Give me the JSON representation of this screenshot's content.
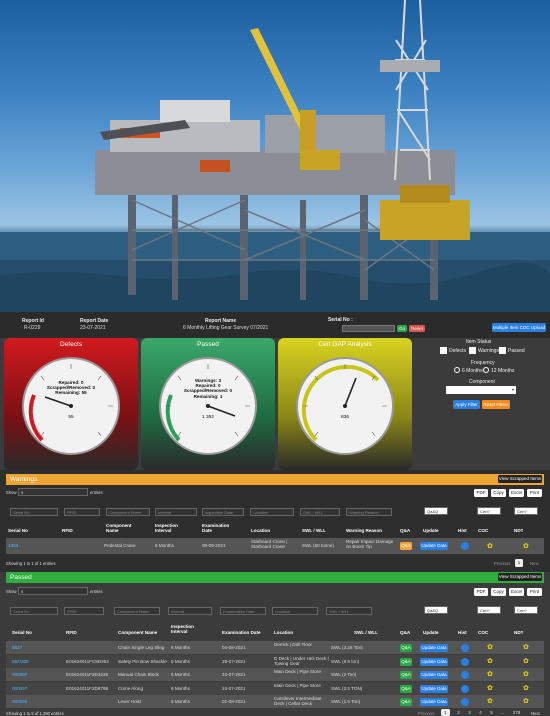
{
  "header": {
    "report_id_label": "Report Id",
    "report_id": "R-0229",
    "report_date_label": "Report Date",
    "report_date": "23-07-2021",
    "report_name_label": "Report Name",
    "report_name": "6 Monthly Lifting Gear Survey 07/2021",
    "serial_label": "Serial No :",
    "go_label": "Go",
    "reset_label": "Reset",
    "multiple_label": "Multiple Item COC Upload"
  },
  "gauges": [
    {
      "title": "Defects",
      "lines": [
        "Repaired: 0",
        "Scrapped/Removed: 0",
        "Remaining: 55"
      ],
      "value": "55",
      "color": "#c0151a"
    },
    {
      "title": "Passed",
      "lines": [
        "Warnings: 3",
        "Repaired: 0",
        "Scrapped/Removed: 0",
        "Remaining: 1"
      ],
      "value": "1 392",
      "color": "#2e9e5b"
    },
    {
      "title": "Cert GAP Analysis",
      "lines": [],
      "value": "836",
      "color": "#c9c41a"
    }
  ],
  "filter": {
    "item_status_label": "Item Status",
    "status_options": [
      "Defects",
      "Warnings",
      "Passed"
    ],
    "frequency_label": "Frequency",
    "frequency_options": [
      "6 Months",
      "12 Months"
    ],
    "component_label": "Component",
    "apply_label": "Apply Filter",
    "reset_label": "Reset Filters"
  },
  "warnings": {
    "title": "Warnings",
    "view_scrapped": "View Scrapped Items",
    "show_label": "Show",
    "show_value": "5",
    "entries_label": "entries",
    "export_buttons": [
      "PDF",
      "Copy",
      "Excel",
      "Print"
    ],
    "filters": [
      "Serial No",
      "RFID",
      "Component Name",
      "Interval",
      "Inspection Date",
      "Location",
      "SWL / WLL",
      "Warning Reason"
    ],
    "filter_selects": [
      "Qa&Q",
      "Cert?",
      "Cert?"
    ],
    "columns": [
      "Serial No",
      "RFID",
      "Component Name",
      "Inspection Interval",
      "Examination Date",
      "Location",
      "SWL / WLL",
      "Warning Reason",
      "Q&A",
      "Update",
      "Hist",
      "COC",
      "NDT"
    ],
    "rows": [
      {
        "serial": "1363",
        "rfid": "",
        "component": "Pedestal Crane",
        "interval": "6 Months",
        "date": "09-09-2021",
        "location": "Starboard Crane | Starboard Crane",
        "swl": "SWL (60 tonne)",
        "reason": "Repair Impact Damage on Boom Tip",
        "qa": "Q&A",
        "update": "Update Data"
      }
    ],
    "info": "Showing 1 to 1 of 1 entries",
    "previous": "Previous",
    "page": "1",
    "next": "Next"
  },
  "passed": {
    "title": "Passed",
    "view_scrapped": "View Scrapped Items",
    "show_label": "Show",
    "show_value": "5",
    "entries_label": "entries",
    "export_buttons": [
      "PDF",
      "Copy",
      "Excel",
      "Print"
    ],
    "filters": [
      "Serial No",
      "RFID",
      "Component Name",
      "Interval",
      "Examination Date",
      "Location",
      "SWL / WLL"
    ],
    "filter_selects": [
      "Qa&Q",
      "Cert?",
      "Cert?"
    ],
    "columns": [
      "Serial No",
      "RFID",
      "Component Name",
      "Inspection Interval",
      "Examination Date",
      "Location",
      "SWL / WLL",
      "Q&A",
      "Update",
      "Hist",
      "COC",
      "NDT"
    ],
    "rows": [
      {
        "serial": "5627",
        "rfid": "",
        "component": "Chain Single Leg Sling",
        "interval": "6 Months",
        "date": "04-08-2021",
        "location": "Derrick | Drill Floor",
        "swl": "SWL (3.26 Ton)"
      },
      {
        "serial": "06/0208",
        "rfid": "E01624011FC8D354",
        "component": "Safety Pin Bow Shackle",
        "interval": "6 Months",
        "date": "29-07-2021",
        "location": "D Deck | Under Heli Deck | Towing Gear",
        "swl": "SWL (8.5 ton)"
      },
      {
        "serial": "000067",
        "rfid": "E01624011F2D3226",
        "component": "Manual Chain Block",
        "interval": "6 Months",
        "date": "24-07-2021",
        "location": "Main Deck | Pipe Store",
        "swl": "SWL (2 Ton)"
      },
      {
        "serial": "000057",
        "rfid": "E01624011F2D8798",
        "component": "Come Along",
        "interval": "6 Months",
        "date": "24-07-2021",
        "location": "Main Deck | Pipe Store",
        "swl": "SWL (2.5 TON)"
      },
      {
        "serial": "000091",
        "rfid": "",
        "component": "Lever Hoist",
        "interval": "6 Months",
        "date": "01-08-2021",
        "location": "Cantilever Intermediate Deck | Cellar Deck",
        "swl": "SWL (1.6 Ton)"
      }
    ],
    "qa": "Q&A",
    "update": "Update Data",
    "info": "Showing 1 to 5 of 1,390 entries",
    "previous": "Previous",
    "pages": [
      "1",
      "2",
      "3",
      "4",
      "5",
      "...",
      "278"
    ],
    "next": "Next"
  }
}
